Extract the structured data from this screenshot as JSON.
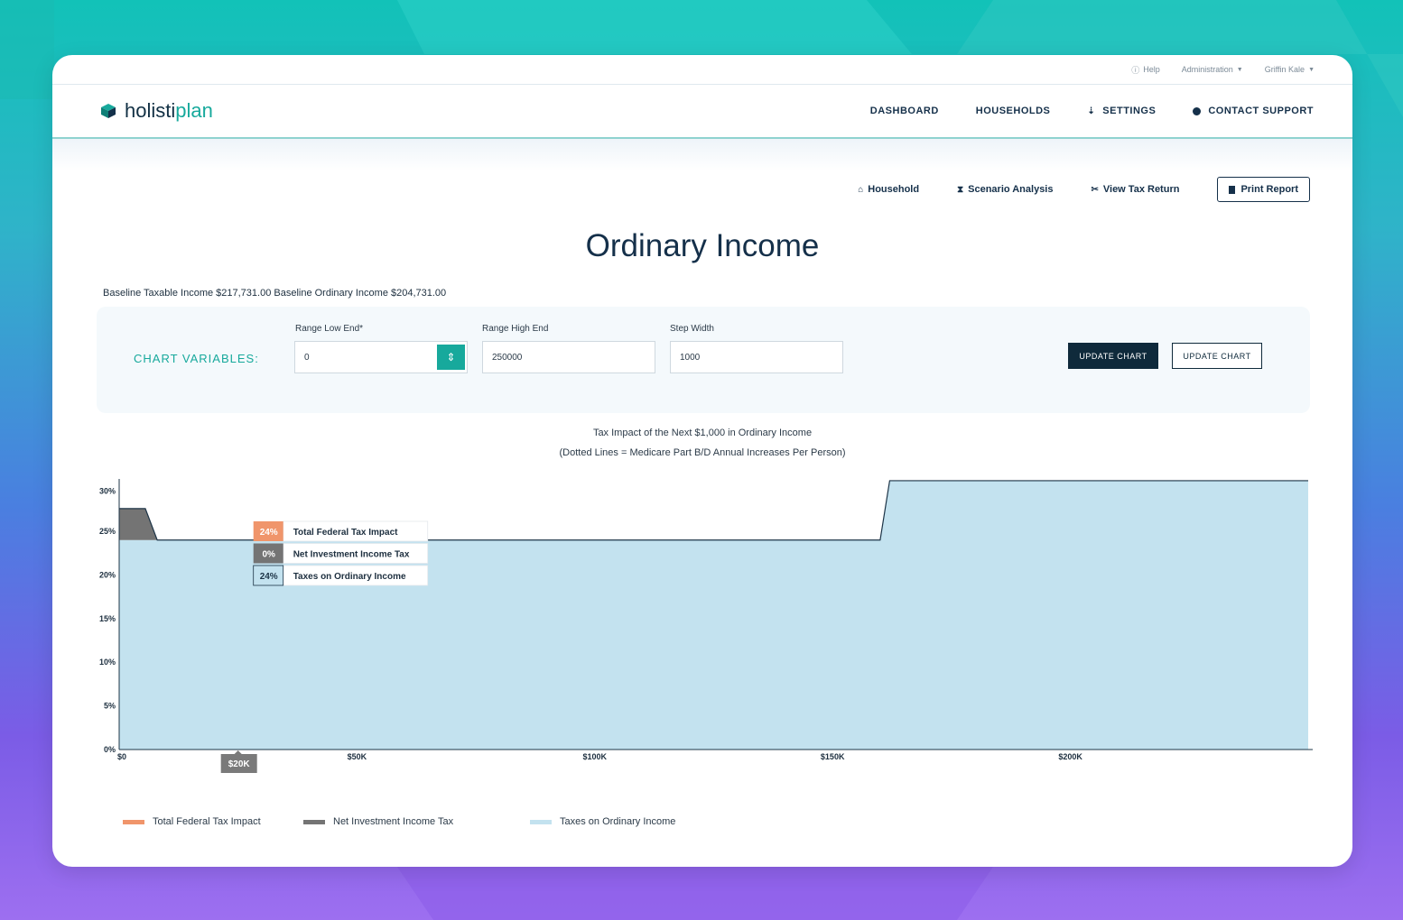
{
  "topbar": {
    "help": "Help",
    "admin": "Administration",
    "user": "Griffin Kale"
  },
  "logo": {
    "part1": "holisti",
    "part2": "plan"
  },
  "nav": {
    "dashboard": "DASHBOARD",
    "households": "HOUSEHOLDS",
    "settings": "SETTINGS",
    "support": "CONTACT SUPPORT"
  },
  "subnav": {
    "household": "Household",
    "scenario": "Scenario Analysis",
    "tax_return": "View Tax Return",
    "print": "Print Report"
  },
  "page_title": "Ordinary Income",
  "baseline_text": "Baseline Taxable Income $217,731.00 Baseline Ordinary Income $204,731.00",
  "variables": {
    "label": "CHART VARIABLES:",
    "low_label": "Range Low End*",
    "low_value": "0",
    "high_label": "Range High End",
    "high_value": "250000",
    "step_label": "Step Width",
    "step_value": "1000",
    "update_dark": "UPDATE CHART",
    "update_light": "UPDATE CHART"
  },
  "chart_data": {
    "type": "area",
    "title": "Tax Impact of the Next $1,000 in Ordinary Income",
    "subtitle": "(Dotted Lines = Medicare Part B/D Annual Increases Per Person)",
    "xlim": [
      0,
      250000
    ],
    "ylim": [
      0,
      31
    ],
    "x_ticks": [
      {
        "value": 0,
        "label": "$0"
      },
      {
        "value": 50000,
        "label": "$50K"
      },
      {
        "value": 100000,
        "label": "$100K"
      },
      {
        "value": 150000,
        "label": "$150K"
      },
      {
        "value": 200000,
        "label": "$200K"
      }
    ],
    "y_ticks": [
      {
        "value": 0,
        "label": "0%"
      },
      {
        "value": 5,
        "label": "5%"
      },
      {
        "value": 10,
        "label": "10%"
      },
      {
        "value": 15,
        "label": "15%"
      },
      {
        "value": 20,
        "label": "20%"
      },
      {
        "value": 25,
        "label": "25%"
      },
      {
        "value": 30,
        "label": "30%"
      }
    ],
    "series": [
      {
        "name": "Taxes on Ordinary Income",
        "color": "#c3e2ef",
        "x": [
          0,
          8000,
          160000,
          162000,
          250000
        ],
        "y": [
          24,
          24,
          24,
          33,
          33
        ]
      },
      {
        "name": "Net Investment Income Tax",
        "color": "#747474",
        "x": [
          0,
          5500,
          8000
        ],
        "y": [
          3.6,
          3.6,
          0
        ]
      },
      {
        "name": "Total Federal Tax Impact",
        "color": "#f0956b",
        "x": [
          0,
          5500,
          8000,
          160000,
          162000,
          250000
        ],
        "y": [
          27.6,
          27.6,
          24,
          24,
          33,
          33
        ]
      }
    ],
    "tooltip": {
      "x_label": "$20K",
      "x": 25000,
      "rows": [
        {
          "value": "24%",
          "label": "Total Federal Tax Impact",
          "color": "#f0956b"
        },
        {
          "value": "0%",
          "label": "Net Investment Income Tax",
          "color": "#747474"
        },
        {
          "value": "24%",
          "label": "Taxes on Ordinary Income",
          "color": "#c3e2ef"
        }
      ]
    },
    "legend": [
      {
        "name": "Total Federal Tax Impact",
        "color": "#f0956b"
      },
      {
        "name": "Net Investment Income Tax",
        "color": "#747474"
      },
      {
        "name": "Taxes on Ordinary Income",
        "color": "#c3e2ef"
      }
    ],
    "legend_position": "bottom-left"
  }
}
